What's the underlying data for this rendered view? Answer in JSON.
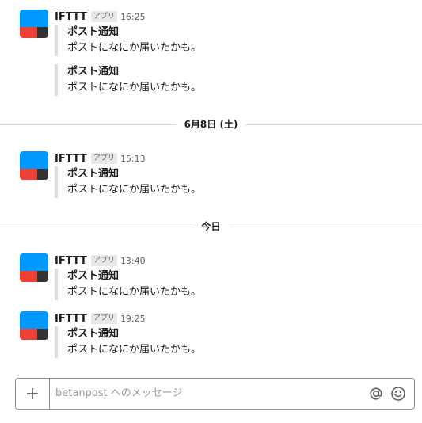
{
  "messages": [
    {
      "sender": "IFTTT",
      "badge": "アプリ",
      "time": "16:25",
      "title": "ポスト通知",
      "text": "ポストになにか届いたかも。"
    },
    {
      "title": "ポスト通知",
      "text": "ポストになにか届いたかも。"
    },
    {
      "sender": "IFTTT",
      "badge": "アプリ",
      "time": "15:13",
      "title": "ポスト通知",
      "text": "ポストになにか届いたかも。"
    },
    {
      "sender": "IFTTT",
      "badge": "アプリ",
      "time": "13:40",
      "title": "ポスト通知",
      "text": "ポストになにか届いたかも。"
    },
    {
      "sender": "IFTTT",
      "badge": "アプリ",
      "time": "19:25",
      "title": "ポスト通知",
      "text": "ポストになにか届いたかも。"
    }
  ],
  "dividers": [
    "6月8日 (土)",
    "今日"
  ],
  "composer": {
    "placeholder": "betanpost へのメッセージ",
    "plus_icon": "plus-icon",
    "mention_icon": "at-icon",
    "emoji_icon": "emoji-icon"
  },
  "colors": {
    "avatar_blue": "#0099ff",
    "avatar_red": "#ee4035",
    "avatar_dark": "#333333",
    "attachment_bar": "#dddddd"
  }
}
